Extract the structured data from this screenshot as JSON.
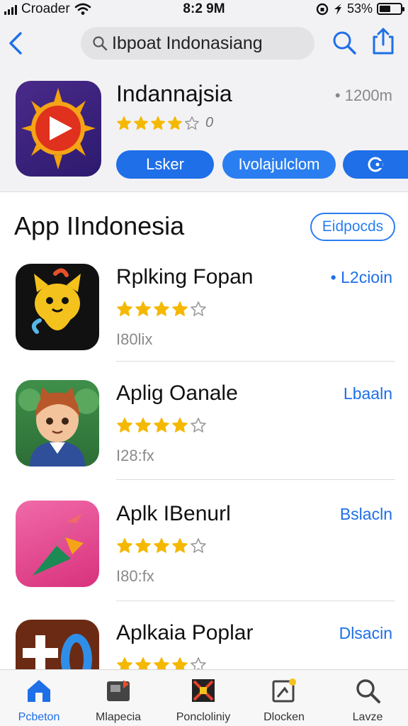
{
  "status_bar": {
    "carrier": "Croader",
    "time": "8:2 9M",
    "battery": "53%",
    "battery_level": 0.53
  },
  "header": {
    "search_value": "Ibpoat Indonasiang",
    "featured": {
      "title": "Indannajsia",
      "meta": "• 1200m",
      "rating": 4,
      "rating_count": "0",
      "primary_button": "Lsker",
      "secondary_button": "Ivolajulclom"
    }
  },
  "section": {
    "title": "App IIndonesia",
    "button": "Eidpocds"
  },
  "apps": [
    {
      "name": "Rplking Fopan",
      "action": "• L2cioin",
      "size": "I80lix",
      "rating": 4
    },
    {
      "name": "Aplig Oanale",
      "action": "Lbaaln",
      "size": "I28:fx",
      "rating": 4
    },
    {
      "name": "Aplk IBenurl",
      "action": "Bslacln",
      "size": "I80:fx",
      "rating": 4
    },
    {
      "name": "Aplkaia Poplar",
      "action": "Dlsacin",
      "size": "",
      "rating": 4
    }
  ],
  "tabs": [
    {
      "label": "Pcbeton",
      "icon": "home-icon"
    },
    {
      "label": "Mlapecia",
      "icon": "apps-icon"
    },
    {
      "label": "Poncloliniy",
      "icon": "games-icon"
    },
    {
      "label": "Dlocken",
      "icon": "updates-icon"
    },
    {
      "label": "Lavze",
      "icon": "search-icon"
    }
  ],
  "colors": {
    "accent": "#1e6fe8",
    "star": "#f5b800"
  }
}
